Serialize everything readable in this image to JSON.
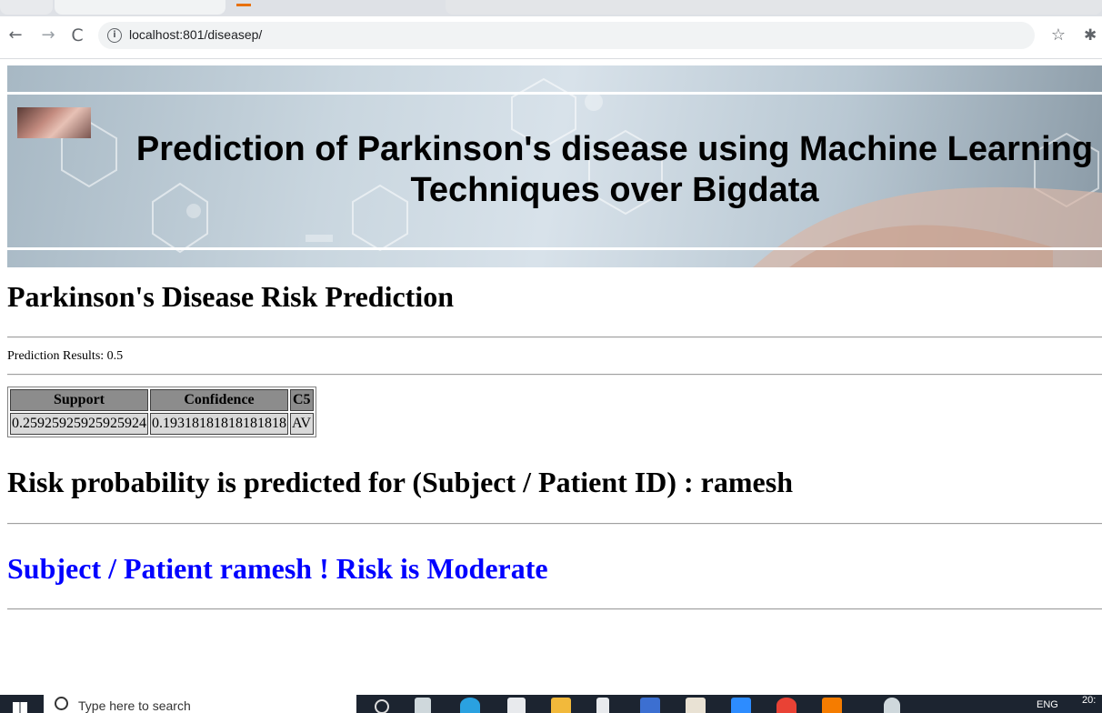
{
  "browser": {
    "url": "localhost:801/diseasep/",
    "nav": {
      "back": "←",
      "forward": "→",
      "reload": "C"
    },
    "info_glyph": "i",
    "star_glyph": "☆",
    "extension_glyph": "✱"
  },
  "banner": {
    "title": "Prediction of Parkinson's disease using Machine Learning Techniques over Bigdata"
  },
  "page": {
    "heading": "Parkinson's Disease Risk Prediction",
    "prediction_results": "Prediction Results: 0.5",
    "table": {
      "headers": [
        "Support",
        "Confidence",
        "C5"
      ],
      "rows": [
        [
          "0.25925925925925924",
          "0.19318181818181818",
          "AV"
        ]
      ]
    },
    "risk_statement": "Risk probability is predicted for (Subject / Patient ID) : ramesh",
    "risk_result": "Subject / Patient ramesh ! Risk is Moderate"
  },
  "taskbar": {
    "search_placeholder": "Type here to search",
    "tray_text": "ENG",
    "clock": "20:"
  },
  "colors": {
    "result_text": "#0000ff",
    "table_header": "#8c8c8c",
    "table_cell": "#d9d9d9"
  }
}
